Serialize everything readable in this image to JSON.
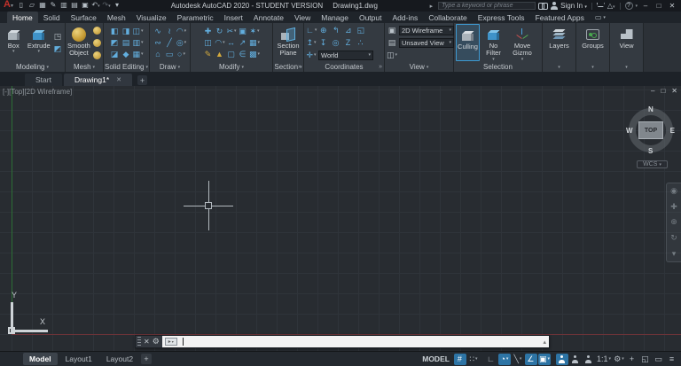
{
  "colors": {
    "accent_blue": "#3d9ad2",
    "toggle_on_blue": "#2d74a5",
    "ribbon_icon_blue": "#62aede",
    "mesh_gold": "#c9a23f",
    "axis_green": "#2c6e35",
    "axis_red": "#6e3338",
    "logo_red": "#c2312b"
  },
  "title_bar": {
    "logo_letter": "A",
    "logo_dd": "▾",
    "quick_access": [
      {
        "name": "new-file-icon",
        "glyph": "▯"
      },
      {
        "name": "open-file-icon",
        "glyph": "▱"
      },
      {
        "name": "save-icon",
        "glyph": "▦"
      },
      {
        "name": "save-as-icon",
        "glyph": "✎"
      },
      {
        "name": "save-all-icon",
        "glyph": "▥"
      },
      {
        "name": "open-from-web-icon",
        "glyph": "▤"
      },
      {
        "name": "plot-icon",
        "glyph": "▣"
      },
      {
        "name": "undo-icon",
        "glyph": "↶",
        "dd": "▾"
      },
      {
        "name": "redo-icon",
        "glyph": "↷",
        "dd": "▾",
        "classes": "dim"
      },
      {
        "name": "qat-customize-icon",
        "glyph": "▾"
      }
    ],
    "title_product": "Autodesk AutoCAD 2020 - STUDENT VERSION",
    "title_document": "Drawing1.dwg",
    "keytip_arrow": "▸",
    "search_placeholder": "Type a keyword or phrase",
    "sign_in_label": "Sign In",
    "sign_in_dd": "▾",
    "app_store_glyph": "△",
    "app_store_dd": "▾",
    "help_glyph": "?",
    "help_dd": "▾",
    "window_controls": {
      "minimize": "–",
      "restore": "□",
      "close": "✕"
    }
  },
  "ribbon": {
    "tabs": [
      {
        "name": "tab-home",
        "label": "Home",
        "classes": "active"
      },
      {
        "name": "tab-solid",
        "label": "Solid"
      },
      {
        "name": "tab-surface",
        "label": "Surface"
      },
      {
        "name": "tab-mesh",
        "label": "Mesh"
      },
      {
        "name": "tab-visualize",
        "label": "Visualize"
      },
      {
        "name": "tab-parametric",
        "label": "Parametric"
      },
      {
        "name": "tab-insert",
        "label": "Insert"
      },
      {
        "name": "tab-annotate",
        "label": "Annotate"
      },
      {
        "name": "tab-view",
        "label": "View"
      },
      {
        "name": "tab-manage",
        "label": "Manage"
      },
      {
        "name": "tab-output",
        "label": "Output"
      },
      {
        "name": "tab-addins",
        "label": "Add-ins"
      },
      {
        "name": "tab-collaborate",
        "label": "Collaborate"
      },
      {
        "name": "tab-express-tools",
        "label": "Express Tools"
      },
      {
        "name": "tab-featured-apps",
        "label": "Featured Apps"
      }
    ],
    "tab_toggle": {
      "glyph": "▭",
      "dd": "▾"
    },
    "modeling": {
      "label": "Modeling",
      "dd": "▾",
      "box_label": "Box",
      "box_dd": "▾",
      "extrude_label": "Extrude",
      "extrude_dd": "▾",
      "small": [
        {
          "name": "presspull-icon",
          "glyph": "◳",
          "classes": "gray"
        },
        {
          "name": "polysolid-icon",
          "glyph": "◩"
        }
      ]
    },
    "mesh": {
      "label": "Mesh",
      "dd": "▾",
      "smooth_label": "Smooth Object",
      "small": [
        {
          "name": "smooth-more-icon"
        },
        {
          "name": "smooth-less-icon"
        },
        {
          "name": "mesh-refine-icon"
        }
      ]
    },
    "solid_editing": {
      "label": "Solid Editing",
      "dd": "▾",
      "tools": [
        {
          "name": "solid-union-icon",
          "glyph": "◧"
        },
        {
          "name": "slice-icon",
          "glyph": "◨"
        },
        {
          "name": "thicken-icon",
          "glyph": "◫",
          "dd": "▾"
        },
        {
          "name": "solid-subtract-icon",
          "glyph": "◩"
        },
        {
          "name": "interfere-icon",
          "glyph": "▤"
        },
        {
          "name": "shell-icon",
          "glyph": "▥",
          "dd": "▾"
        },
        {
          "name": "solid-intersect-icon",
          "glyph": "◪"
        },
        {
          "name": "imprint-icon",
          "glyph": "◆"
        },
        {
          "name": "separate-icon",
          "glyph": "▦",
          "dd": "▾"
        }
      ]
    },
    "draw": {
      "label": "Draw",
      "dd": "▾",
      "tools": [
        {
          "name": "polyline-icon",
          "glyph": "∿"
        },
        {
          "name": "3d-polyline-icon",
          "glyph": "≀"
        },
        {
          "name": "arc-icon",
          "glyph": "◠",
          "dd": "▾"
        },
        {
          "name": "spline-icon",
          "glyph": "∾"
        },
        {
          "name": "line-icon",
          "glyph": "╱"
        },
        {
          "name": "circle-icon",
          "glyph": "◎",
          "dd": "▾"
        },
        {
          "name": "polygon-icon",
          "glyph": "⌂"
        },
        {
          "name": "rectangle-icon",
          "glyph": "▭"
        },
        {
          "name": "ellipse-icon",
          "glyph": "○",
          "dd": "▾"
        }
      ]
    },
    "modify": {
      "label": "Modify",
      "dd": "▾",
      "tools": [
        {
          "name": "move-icon",
          "glyph": "✚"
        },
        {
          "name": "rotate-icon",
          "glyph": "↻"
        },
        {
          "name": "trim-icon",
          "glyph": "✂",
          "dd": "▾"
        },
        {
          "name": "copy-icon",
          "glyph": "▣"
        },
        {
          "name": "explode-icon",
          "glyph": "✶",
          "dd": "▾"
        },
        {
          "name": "mirror-icon",
          "glyph": "◫"
        },
        {
          "name": "fillet-icon",
          "glyph": "◠",
          "dd": "▾"
        },
        {
          "name": "stretch-icon",
          "glyph": "↔"
        },
        {
          "name": "scale-icon",
          "glyph": "↗"
        },
        {
          "name": "array-icon",
          "glyph": "▦",
          "dd": "▾"
        },
        {
          "name": "erase-icon",
          "glyph": "✎",
          "classes": "gold"
        },
        {
          "name": "measure-icon",
          "glyph": "▲",
          "classes": "gold"
        },
        {
          "name": "rectangle-array-icon",
          "glyph": "▢"
        },
        {
          "name": "offset-icon",
          "glyph": "∈"
        },
        {
          "name": "more-modify-icon",
          "glyph": "▩",
          "dd": "▾"
        }
      ]
    },
    "section": {
      "label": "Section",
      "dd": "▾",
      "launcher": "»",
      "button_label": "Section Plane"
    },
    "coordinates": {
      "label": "Coordinates",
      "launcher": "»",
      "tools_r1": [
        {
          "name": "ucs-icon",
          "glyph": "∟",
          "dd": "▾"
        },
        {
          "name": "ucs-world-icon",
          "glyph": "⊕"
        },
        {
          "name": "ucs-previous-icon",
          "glyph": "↰"
        },
        {
          "name": "ucs-object-icon",
          "glyph": "⊿"
        },
        {
          "name": "ucs-face-icon",
          "glyph": "◱"
        }
      ],
      "tools_r2": [
        {
          "name": "ucs-origin-icon",
          "glyph": "↥",
          "dd": "▾"
        },
        {
          "name": "ucs-z-axis-icon",
          "glyph": "↧"
        },
        {
          "name": "ucs-view-icon",
          "glyph": "◎"
        },
        {
          "name": "ucs-z-rotate-icon",
          "glyph": "Z"
        },
        {
          "name": "ucs-3point-icon",
          "glyph": "∴"
        }
      ],
      "show_ucs": {
        "name": "show-ucs-icon-icon",
        "glyph": "✛",
        "dd": "▾"
      },
      "world_value": "World",
      "world_dd": "▾"
    },
    "view_panel": {
      "label": "View",
      "dd": "▾",
      "visual_style_icon": "▣",
      "visual_style": "2D Wireframe",
      "vs_dd": "▾",
      "named_view_icon": "▤",
      "named_view": "Unsaved View",
      "nv_dd": "▾",
      "viewport_icon": "◫",
      "viewport_dd": "▾"
    },
    "selection": {
      "label": "Selection",
      "culling_label": "Culling",
      "no_filter_label": "No Filter",
      "no_filter_dd": "▾",
      "move_gizmo_label": "Move Gizmo",
      "move_gizmo_dd": "▾"
    },
    "layers_panel": {
      "label": "Layers",
      "dd": "▾"
    },
    "groups_panel": {
      "label": "Groups",
      "dd": "▾"
    },
    "views_panel": {
      "label": "View",
      "dd": "▾"
    }
  },
  "file_tabs": {
    "tabs": [
      {
        "name": "file-tab-start",
        "label": "Start",
        "close": ""
      },
      {
        "name": "file-tab-drawing1",
        "label": "Drawing1*",
        "classes": "active",
        "close": "✕"
      }
    ],
    "add_label": "+"
  },
  "viewport": {
    "label": "[-][Top][2D Wireframe]",
    "controls": {
      "minimize": "–",
      "restore": "□",
      "close": "✕"
    },
    "viewcube": {
      "north": "N",
      "south": "S",
      "east": "E",
      "west": "W",
      "top": "TOP",
      "wcs": "WCS",
      "wcs_dd": "▾"
    },
    "navbar_icons": [
      {
        "name": "navigation-wheel-icon",
        "glyph": "◉"
      },
      {
        "name": "pan-icon",
        "glyph": "✚"
      },
      {
        "name": "zoom-icon",
        "glyph": "⊕"
      },
      {
        "name": "orbit-icon",
        "glyph": "↻"
      },
      {
        "name": "navbar-more-icon",
        "glyph": "▾"
      }
    ],
    "ucs_x": "X",
    "ucs_y": "Y"
  },
  "command_line": {
    "close": "✕",
    "wrench": "⚙",
    "badge_glyph": "▸",
    "badge_dd": "▾",
    "value": "",
    "recent_arrow": "▴"
  },
  "status_bar": {
    "layout_tabs": [
      {
        "name": "model-tab",
        "label": "Model",
        "classes": "active"
      },
      {
        "name": "layout1-tab",
        "label": "Layout1"
      },
      {
        "name": "layout2-tab",
        "label": "Layout2"
      }
    ],
    "add_layout_label": "+",
    "space_label": "MODEL",
    "toggles": [
      {
        "name": "grid-display-icon",
        "glyph": "#",
        "classes": "on"
      },
      {
        "name": "snap-mode-icon",
        "glyph": "∷",
        "dd": "▾"
      },
      {
        "name": "ortho-mode-icon",
        "glyph": "∟",
        "classes": "gap"
      },
      {
        "name": "polar-tracking-icon",
        "glyph": "◔",
        "classes": "on",
        "dd": "▾"
      },
      {
        "name": "isometric-drafting-icon",
        "glyph": "╲",
        "dd": "▾"
      },
      {
        "name": "object-snap-tracking-icon",
        "glyph": "∠",
        "classes": "on"
      },
      {
        "name": "object-snap-icon",
        "glyph": "▣",
        "classes": "on",
        "dd": "▾"
      },
      {
        "name": "annotation-visibility-icon",
        "glyph": "",
        "classes": "on g-person gap"
      },
      {
        "name": "annotation-autoscale-icon",
        "glyph": "",
        "classes": "g-person"
      },
      {
        "name": "annotation-scale-person-icon",
        "glyph": "",
        "classes": "g-person"
      }
    ],
    "annotation_scale": "1:1",
    "scale_dd": "▾",
    "right_icons": [
      {
        "name": "workspace-switching-icon",
        "glyph": "⚙",
        "dd": "▾"
      },
      {
        "name": "annotation-monitor-icon",
        "glyph": "+"
      },
      {
        "name": "isolate-objects-icon",
        "glyph": "◱"
      },
      {
        "name": "graphics-performance-icon",
        "glyph": "▭"
      },
      {
        "name": "customization-icon",
        "glyph": "≡"
      }
    ]
  }
}
